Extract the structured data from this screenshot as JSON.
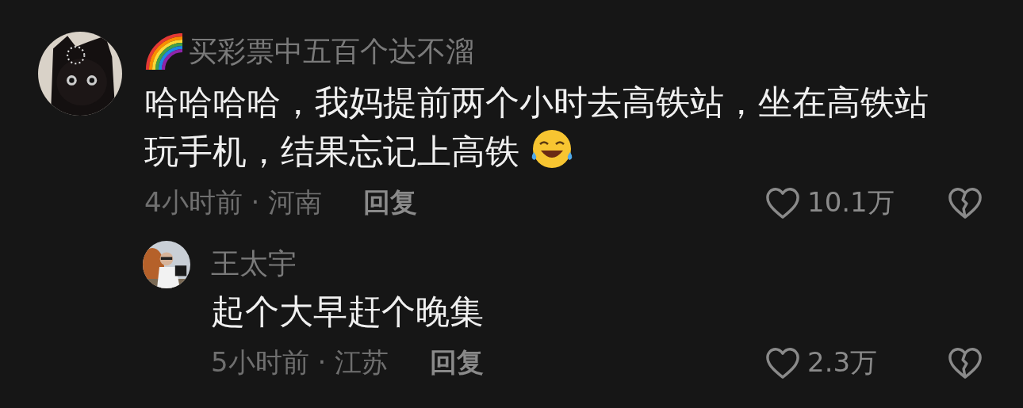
{
  "comments": [
    {
      "badge_icon": true,
      "author": "买彩票中五百个达不溜",
      "text": "哈哈哈哈，我妈提前两个小时去高铁站，坐在高铁站玩手机，结果忘记上高铁",
      "trailing_icon": true,
      "meta": "4小时前 · 河南",
      "reply_label": "回复",
      "likes": "10.1万",
      "is_reply": false
    },
    {
      "badge_icon": false,
      "author": "王太宇",
      "text": "起个大早赶个晚集",
      "trailing_icon": false,
      "meta": "5小时前 · 江苏",
      "reply_label": "回复",
      "likes": "2.3万",
      "is_reply": true
    }
  ]
}
